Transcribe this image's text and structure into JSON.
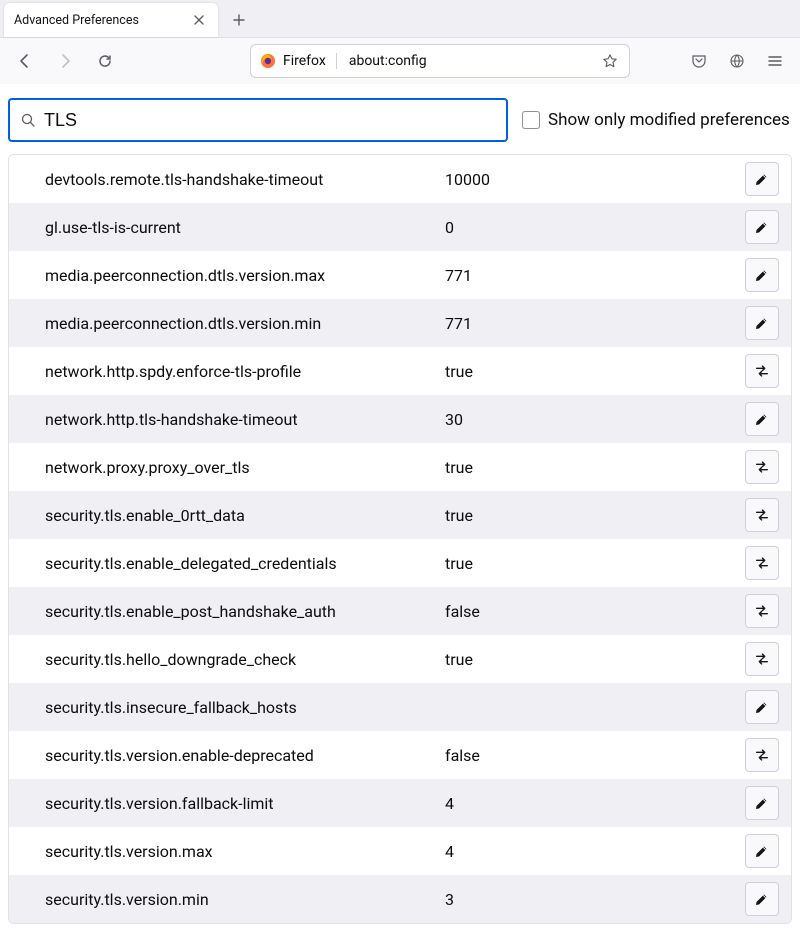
{
  "tab": {
    "title": "Advanced Preferences"
  },
  "urlbar": {
    "label": "Firefox",
    "url": "about:config"
  },
  "search": {
    "value": "TLS"
  },
  "filter": {
    "label": "Show only modified preferences"
  },
  "prefs": [
    {
      "name": "devtools.remote.tls-handshake-timeout",
      "value": "10000",
      "action": "edit"
    },
    {
      "name": "gl.use-tls-is-current",
      "value": "0",
      "action": "edit"
    },
    {
      "name": "media.peerconnection.dtls.version.max",
      "value": "771",
      "action": "edit"
    },
    {
      "name": "media.peerconnection.dtls.version.min",
      "value": "771",
      "action": "edit"
    },
    {
      "name": "network.http.spdy.enforce-tls-profile",
      "value": "true",
      "action": "toggle"
    },
    {
      "name": "network.http.tls-handshake-timeout",
      "value": "30",
      "action": "edit"
    },
    {
      "name": "network.proxy.proxy_over_tls",
      "value": "true",
      "action": "toggle"
    },
    {
      "name": "security.tls.enable_0rtt_data",
      "value": "true",
      "action": "toggle"
    },
    {
      "name": "security.tls.enable_delegated_credentials",
      "value": "true",
      "action": "toggle"
    },
    {
      "name": "security.tls.enable_post_handshake_auth",
      "value": "false",
      "action": "toggle"
    },
    {
      "name": "security.tls.hello_downgrade_check",
      "value": "true",
      "action": "toggle"
    },
    {
      "name": "security.tls.insecure_fallback_hosts",
      "value": "",
      "action": "edit"
    },
    {
      "name": "security.tls.version.enable-deprecated",
      "value": "false",
      "action": "toggle"
    },
    {
      "name": "security.tls.version.fallback-limit",
      "value": "4",
      "action": "edit"
    },
    {
      "name": "security.tls.version.max",
      "value": "4",
      "action": "edit"
    },
    {
      "name": "security.tls.version.min",
      "value": "3",
      "action": "edit"
    }
  ]
}
